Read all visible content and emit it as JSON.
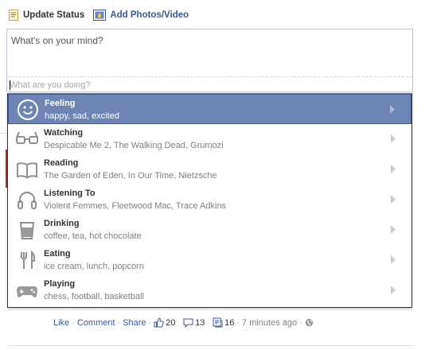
{
  "composer": {
    "tabs": [
      {
        "label": "Update Status",
        "icon": "status-icon"
      },
      {
        "label": "Add Photos/Video",
        "icon": "photo-icon"
      }
    ],
    "status_placeholder": "What's on your mind?",
    "doing_placeholder": "What are you doing?"
  },
  "activities": [
    {
      "title": "Feeling",
      "subtitle": "happy, sad, excited",
      "icon": "smiley-icon",
      "selected": true
    },
    {
      "title": "Watching",
      "subtitle": "Despicable Me 2, The Walking Dead, Grumozi",
      "icon": "glasses-icon"
    },
    {
      "title": "Reading",
      "subtitle": "The Garden of Eden, In Our Time, Nietzsche",
      "icon": "book-icon"
    },
    {
      "title": "Listening To",
      "subtitle": "Violent Femmes, Fleetwood Mac, Trace Adkins",
      "icon": "headphones-icon"
    },
    {
      "title": "Drinking",
      "subtitle": "coffee, tea, hot chocolate",
      "icon": "cup-icon"
    },
    {
      "title": "Eating",
      "subtitle": "ice cream, lunch, popcorn",
      "icon": "fork-knife-icon"
    },
    {
      "title": "Playing",
      "subtitle": "chess, football, basketball",
      "icon": "gamepad-icon"
    }
  ],
  "post_actions": {
    "like": "Like",
    "comment": "Comment",
    "share": "Share",
    "likes_count": "20",
    "comments_count": "13",
    "shares_count": "16",
    "timestamp": "7 minutes ago"
  },
  "colors": {
    "brand_blue": "#3b5998",
    "selected_bg": "#6d84b4",
    "icon_gray": "#9a9a9a"
  }
}
